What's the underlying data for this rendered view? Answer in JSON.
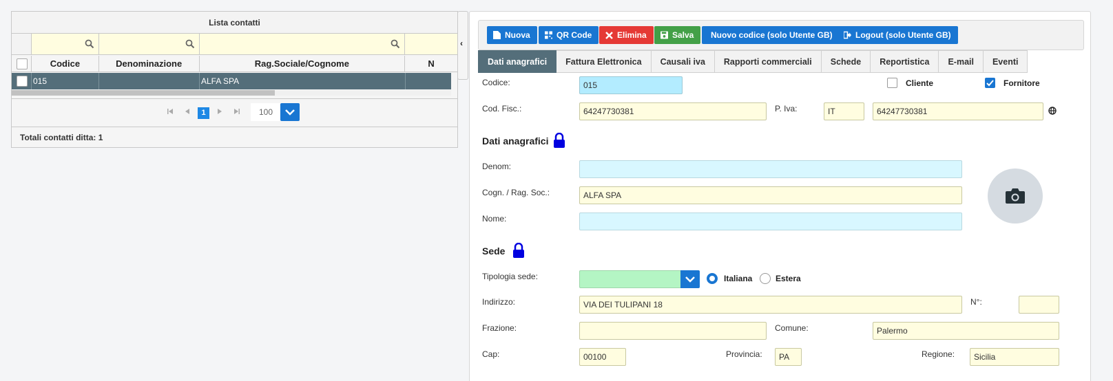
{
  "left": {
    "title": "Lista contatti",
    "columns": [
      "Codice",
      "Denominazione",
      "Rag.Sociale/Cognome",
      "N"
    ],
    "rows": [
      {
        "codice": "015",
        "denominazione": "",
        "rag_sociale": "ALFA SPA"
      }
    ],
    "pager": {
      "page": "1",
      "page_size": "100"
    },
    "totals": "Totali contatti ditta: 1"
  },
  "toolbar": {
    "nuova": "Nuova",
    "qrcode": "QR Code",
    "elimina": "Elimina",
    "salva": "Salva",
    "nuovo_codice": "Nuovo codice (solo Utente GB)",
    "logout": "Logout (solo Utente GB)"
  },
  "tabs": [
    "Dati anagrafici",
    "Fattura Elettronica",
    "Causali iva",
    "Rapporti commerciali",
    "Schede",
    "Reportistica",
    "E-mail",
    "Eventi"
  ],
  "form": {
    "codice_label": "Codice:",
    "codice_value": "015",
    "cliente_label": "Cliente",
    "cliente_checked": false,
    "fornitore_label": "Fornitore",
    "fornitore_checked": true,
    "codfisc_label": "Cod. Fisc.:",
    "codfisc_value": "64247730381",
    "piva_label": "P. Iva:",
    "piva_country": "IT",
    "piva_value": "64247730381",
    "section_anagrafici": "Dati anagrafici",
    "denom_label": "Denom:",
    "denom_value": "",
    "cognome_label": "Cogn. / Rag. Soc.:",
    "cognome_value": "ALFA SPA",
    "nome_label": "Nome:",
    "nome_value": "",
    "section_sede": "Sede",
    "tipologia_label": "Tipologia sede:",
    "tipologia_value": "",
    "italiana_label": "Italiana",
    "italiana_selected": true,
    "estera_label": "Estera",
    "estera_selected": false,
    "indirizzo_label": "Indirizzo:",
    "indirizzo_value": "VIA DEI TULIPANI 18",
    "numero_label": "N°:",
    "numero_value": "",
    "frazione_label": "Frazione:",
    "frazione_value": "",
    "comune_label": "Comune:",
    "comune_value": "Palermo",
    "cap_label": "Cap:",
    "cap_value": "00100",
    "provincia_label": "Provincia:",
    "provincia_value": "PA",
    "regione_label": "Regione:",
    "regione_value": "Sicilia"
  },
  "colors": {
    "primary": "#1976d2",
    "danger": "#e53935",
    "success": "#43a047",
    "selected_row": "#546e7a",
    "input_yellow": "#fffde0",
    "input_cyan": "#d8f7ff",
    "input_green": "#b4f5c4"
  },
  "icons": [
    "search-icon",
    "file-icon",
    "qrcode-icon",
    "close-icon",
    "save-icon",
    "logout-icon",
    "chevron-left-icon",
    "chevron-down-icon",
    "lock-icon",
    "globe-icon",
    "camera-icon",
    "check-icon",
    "first-page-icon",
    "prev-page-icon",
    "next-page-icon",
    "last-page-icon"
  ]
}
